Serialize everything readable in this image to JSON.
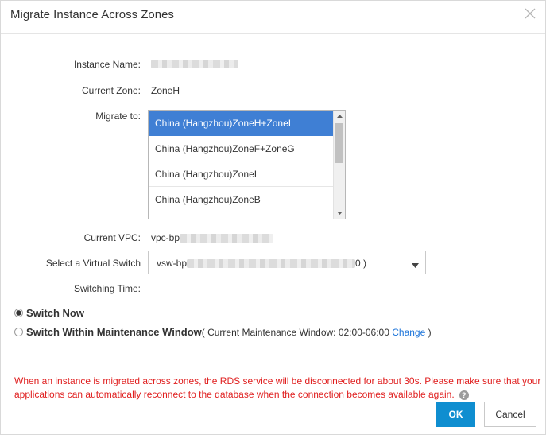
{
  "dialog": {
    "title": "Migrate Instance Across Zones"
  },
  "form": {
    "instance_name_label": "Instance Name:",
    "current_zone_label": "Current Zone:",
    "current_zone_value": "ZoneH",
    "migrate_to_label": "Migrate to:",
    "migrate_options": [
      "China (Hangzhou)ZoneH+ZoneI",
      "China (Hangzhou)ZoneF+ZoneG",
      "China (Hangzhou)ZoneI",
      "China (Hangzhou)ZoneB"
    ],
    "current_vpc_label": "Current VPC:",
    "current_vpc_prefix": "vpc-bp",
    "vswitch_label": "Select a Virtual Switch",
    "vswitch_prefix": "vsw-bp",
    "vswitch_suffix": "0 )",
    "switching_time_label": "Switching Time:",
    "switch_now_label": "Switch Now",
    "switch_window_label": "Switch Within Maintenance Window",
    "maintenance_window_text": "( Current Maintenance Window: 02:00-06:00 ",
    "change_link": "Change",
    "close_paren": " )"
  },
  "warning": "When an instance is migrated across zones, the RDS service will be disconnected for about 30s. Please make sure that your applications can automatically reconnect to the database when the connection becomes available again.",
  "buttons": {
    "ok": "OK",
    "cancel": "Cancel"
  },
  "colors": {
    "selected_option": "#3f7fd4",
    "ok_button": "#0f8ed0",
    "warning_text": "#e02020",
    "link": "#1a73d9"
  }
}
